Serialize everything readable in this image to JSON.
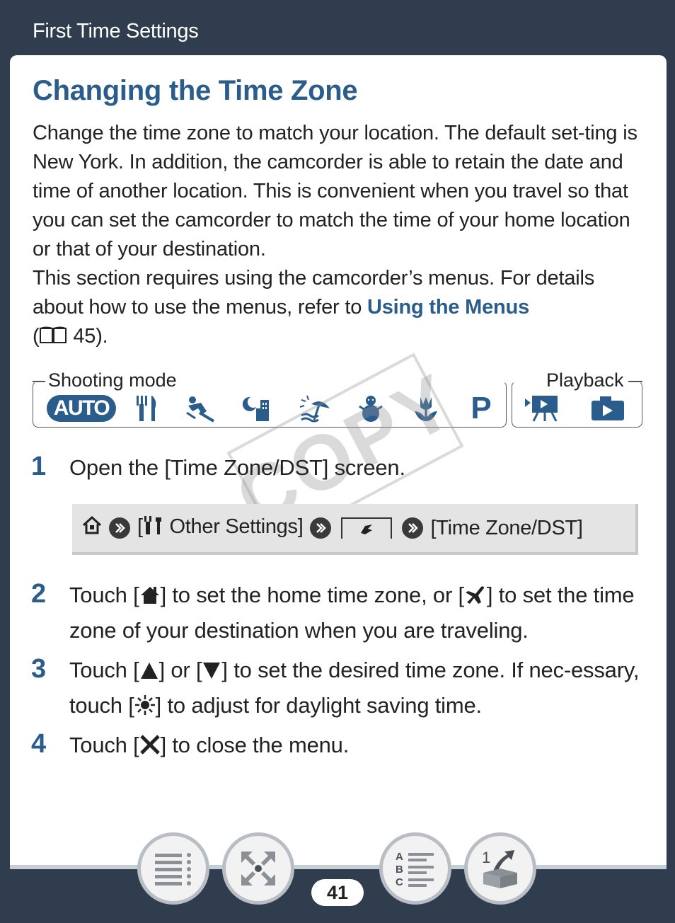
{
  "header": {
    "title": "First Time Settings"
  },
  "section": {
    "title": "Changing the Time Zone",
    "intro_p1": "Change the time zone to match your location. The default set-ting is New York. In addition, the camcorder is able to retain the date and time of another location. This is convenient when you travel so that you can set the camcorder to match the time of your home location or that of your destination.",
    "intro_p2_a": "This section requires using the camcorder’s menus. For details about how to use the menus, refer to ",
    "intro_link": "Using the Menus",
    "intro_p2_b_open": "(",
    "intro_page_ref": "45",
    "intro_p2_b_close": ")."
  },
  "modes": {
    "shooting_label": "Shooting mode",
    "playback_label": "Playback",
    "auto_label": "AUTO",
    "p_label": "P",
    "icons": [
      "cinema-food-icon",
      "sports-icon",
      "night-scene-icon",
      "beach-icon",
      "snow-icon",
      "fireworks-icon"
    ]
  },
  "watermark": "COPY",
  "steps": [
    {
      "num": "1",
      "text": "Open the [Time Zone/DST] screen."
    },
    {
      "num": "2",
      "text_a": "Touch [",
      "text_b": "] to set the home time zone, or [",
      "text_c": "] to set the time zone of your destination when you are traveling."
    },
    {
      "num": "3",
      "text_a": "Touch [",
      "text_b": "] or [",
      "text_c": "] to set the desired time zone. If nec-essary, touch [",
      "text_d": "] to adjust for daylight saving time."
    },
    {
      "num": "4",
      "text_a": "Touch [",
      "text_b": "] to close the menu."
    }
  ],
  "menu_path": {
    "open_bracket": "[",
    "other_settings": "Other Settings]",
    "time_zone": "[Time Zone/DST]"
  },
  "footer": {
    "page_number": "41"
  },
  "colors": {
    "accent": "#2b5d8c",
    "frame": "#2f3d4f"
  }
}
